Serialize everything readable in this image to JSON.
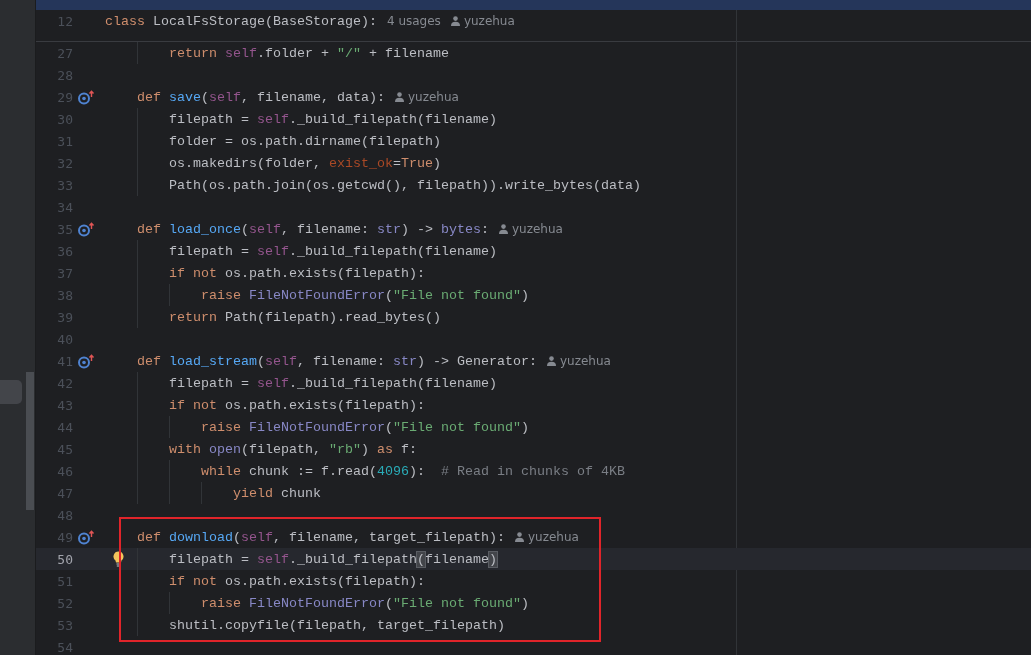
{
  "sticky": {
    "number": "12",
    "tokens": [
      {
        "kind": "keyword",
        "text": "class"
      },
      {
        "kind": "plain",
        "text": " LocalFsStorage(BaseStorage):"
      }
    ],
    "usages": "4 usages",
    "author": "yuzehua"
  },
  "lines": [
    {
      "number": "27",
      "current": false,
      "boxed": false,
      "tokens": [
        {
          "kind": "keyword",
          "text": "        return"
        },
        {
          "kind": "self",
          "text": " self"
        },
        {
          "kind": "plain",
          "text": ".folder + "
        },
        {
          "kind": "string",
          "text": "\"/\""
        },
        {
          "kind": "plain",
          "text": " + filename"
        }
      ]
    },
    {
      "number": "28",
      "current": false,
      "boxed": false
    },
    {
      "number": "29",
      "current": false,
      "boxed": false,
      "gutter": {
        "kind": "override"
      },
      "author": "yuzehua",
      "tokens": [
        {
          "kind": "keyword",
          "text": "    def"
        },
        {
          "kind": "function",
          "text": " save"
        },
        {
          "kind": "plain",
          "text": "("
        },
        {
          "kind": "self",
          "text": "self"
        },
        {
          "kind": "plain",
          "text": ", filename, data):"
        }
      ]
    },
    {
      "number": "30",
      "current": false,
      "boxed": false,
      "tokens": [
        {
          "kind": "plain",
          "text": "        filepath = "
        },
        {
          "kind": "self",
          "text": "self"
        },
        {
          "kind": "plain",
          "text": "._build_filepath(filename)"
        }
      ]
    },
    {
      "number": "31",
      "current": false,
      "boxed": false,
      "tokens": [
        {
          "kind": "plain",
          "text": "        folder = os.path.dirname(filepath)"
        }
      ]
    },
    {
      "number": "32",
      "current": false,
      "boxed": false,
      "tokens": [
        {
          "kind": "plain",
          "text": "        os.makedirs(folder, "
        },
        {
          "kind": "param",
          "text": "exist_ok"
        },
        {
          "kind": "plain",
          "text": "="
        },
        {
          "kind": "keyword",
          "text": "True"
        },
        {
          "kind": "plain",
          "text": ")"
        }
      ]
    },
    {
      "number": "33",
      "current": false,
      "boxed": false,
      "tokens": [
        {
          "kind": "plain",
          "text": "        Path(os.path.join(os.getcwd(), filepath)).write_bytes(data)"
        }
      ]
    },
    {
      "number": "34",
      "current": false,
      "boxed": false
    },
    {
      "number": "35",
      "current": false,
      "boxed": false,
      "gutter": {
        "kind": "override"
      },
      "author": "yuzehua",
      "tokens": [
        {
          "kind": "keyword",
          "text": "    def"
        },
        {
          "kind": "function",
          "text": " load_once"
        },
        {
          "kind": "plain",
          "text": "("
        },
        {
          "kind": "self",
          "text": "self"
        },
        {
          "kind": "plain",
          "text": ", filename: "
        },
        {
          "kind": "builtin",
          "text": "str"
        },
        {
          "kind": "plain",
          "text": ") -> "
        },
        {
          "kind": "builtin",
          "text": "bytes"
        },
        {
          "kind": "plain",
          "text": ":"
        }
      ]
    },
    {
      "number": "36",
      "current": false,
      "boxed": false,
      "tokens": [
        {
          "kind": "plain",
          "text": "        filepath = "
        },
        {
          "kind": "self",
          "text": "self"
        },
        {
          "kind": "plain",
          "text": "._build_filepath(filename)"
        }
      ]
    },
    {
      "number": "37",
      "current": false,
      "boxed": false,
      "tokens": [
        {
          "kind": "keyword",
          "text": "        if not"
        },
        {
          "kind": "plain",
          "text": " os.path.exists(filepath):"
        }
      ]
    },
    {
      "number": "38",
      "current": false,
      "boxed": false,
      "tokens": [
        {
          "kind": "keyword",
          "text": "            raise"
        },
        {
          "kind": "builtin",
          "text": " FileNotFoundError"
        },
        {
          "kind": "plain",
          "text": "("
        },
        {
          "kind": "string",
          "text": "\"File not found\""
        },
        {
          "kind": "plain",
          "text": ")"
        }
      ]
    },
    {
      "number": "39",
      "current": false,
      "boxed": false,
      "tokens": [
        {
          "kind": "keyword",
          "text": "        return"
        },
        {
          "kind": "plain",
          "text": " Path(filepath).read_bytes()"
        }
      ]
    },
    {
      "number": "40",
      "current": false,
      "boxed": false
    },
    {
      "number": "41",
      "current": false,
      "boxed": false,
      "gutter": {
        "kind": "override"
      },
      "author": "yuzehua",
      "tokens": [
        {
          "kind": "keyword",
          "text": "    def"
        },
        {
          "kind": "function",
          "text": " load_stream"
        },
        {
          "kind": "plain",
          "text": "("
        },
        {
          "kind": "self",
          "text": "self"
        },
        {
          "kind": "plain",
          "text": ", filename: "
        },
        {
          "kind": "builtin",
          "text": "str"
        },
        {
          "kind": "plain",
          "text": ") -> Generator:"
        }
      ]
    },
    {
      "number": "42",
      "current": false,
      "boxed": false,
      "tokens": [
        {
          "kind": "plain",
          "text": "        filepath = "
        },
        {
          "kind": "self",
          "text": "self"
        },
        {
          "kind": "plain",
          "text": "._build_filepath(filename)"
        }
      ]
    },
    {
      "number": "43",
      "current": false,
      "boxed": false,
      "tokens": [
        {
          "kind": "keyword",
          "text": "        if not"
        },
        {
          "kind": "plain",
          "text": " os.path.exists(filepath):"
        }
      ]
    },
    {
      "number": "44",
      "current": false,
      "boxed": false,
      "tokens": [
        {
          "kind": "keyword",
          "text": "            raise"
        },
        {
          "kind": "builtin",
          "text": " FileNotFoundError"
        },
        {
          "kind": "plain",
          "text": "("
        },
        {
          "kind": "string",
          "text": "\"File not found\""
        },
        {
          "kind": "plain",
          "text": ")"
        }
      ]
    },
    {
      "number": "45",
      "current": false,
      "boxed": false,
      "tokens": [
        {
          "kind": "keyword",
          "text": "        with"
        },
        {
          "kind": "builtin",
          "text": " open"
        },
        {
          "kind": "plain",
          "text": "(filepath, "
        },
        {
          "kind": "string",
          "text": "\"rb\""
        },
        {
          "kind": "plain",
          "text": ") "
        },
        {
          "kind": "keyword",
          "text": "as"
        },
        {
          "kind": "plain",
          "text": " f:"
        }
      ]
    },
    {
      "number": "46",
      "current": false,
      "boxed": false,
      "tokens": [
        {
          "kind": "keyword",
          "text": "            while"
        },
        {
          "kind": "plain",
          "text": " chunk := f.read("
        },
        {
          "kind": "number",
          "text": "4096"
        },
        {
          "kind": "plain",
          "text": "):  "
        },
        {
          "kind": "comment",
          "text": "# Read in chunks of 4KB"
        }
      ]
    },
    {
      "number": "47",
      "current": false,
      "boxed": false,
      "tokens": [
        {
          "kind": "keyword",
          "text": "                yield"
        },
        {
          "kind": "plain",
          "text": " chunk"
        }
      ]
    },
    {
      "number": "48",
      "current": false,
      "boxed": false
    },
    {
      "number": "49",
      "current": false,
      "boxed": true,
      "gutter": {
        "kind": "override"
      },
      "author": "yuzehua",
      "tokens": [
        {
          "kind": "keyword",
          "text": "    def"
        },
        {
          "kind": "function",
          "text": " download"
        },
        {
          "kind": "plain",
          "text": "("
        },
        {
          "kind": "self",
          "text": "self"
        },
        {
          "kind": "plain",
          "text": ", filename, target_filepath):"
        }
      ]
    },
    {
      "number": "50",
      "current": true,
      "boxed": true,
      "gutter": {
        "kind": "bulb"
      },
      "tokens": [
        {
          "kind": "plain",
          "text": "        filepath = "
        },
        {
          "kind": "self",
          "text": "self"
        },
        {
          "kind": "plain",
          "text": "._build_filepath"
        },
        {
          "kind": "match",
          "text": "("
        },
        {
          "kind": "plain",
          "text": "filename"
        },
        {
          "kind": "match",
          "text": ")"
        }
      ]
    },
    {
      "number": "51",
      "current": false,
      "boxed": true,
      "tokens": [
        {
          "kind": "keyword",
          "text": "        if not"
        },
        {
          "kind": "plain",
          "text": " os.path.exists(filepath):"
        }
      ]
    },
    {
      "number": "52",
      "current": false,
      "boxed": true,
      "tokens": [
        {
          "kind": "keyword",
          "text": "            raise"
        },
        {
          "kind": "builtin",
          "text": " FileNotFoundError"
        },
        {
          "kind": "plain",
          "text": "("
        },
        {
          "kind": "string",
          "text": "\"File not found\""
        },
        {
          "kind": "plain",
          "text": ")"
        }
      ]
    },
    {
      "number": "53",
      "current": false,
      "boxed": true,
      "tokens": [
        {
          "kind": "plain",
          "text": "        shutil.copyfile(filepath, target_filepath)"
        }
      ]
    },
    {
      "number": "54",
      "current": false,
      "boxed": false
    }
  ]
}
